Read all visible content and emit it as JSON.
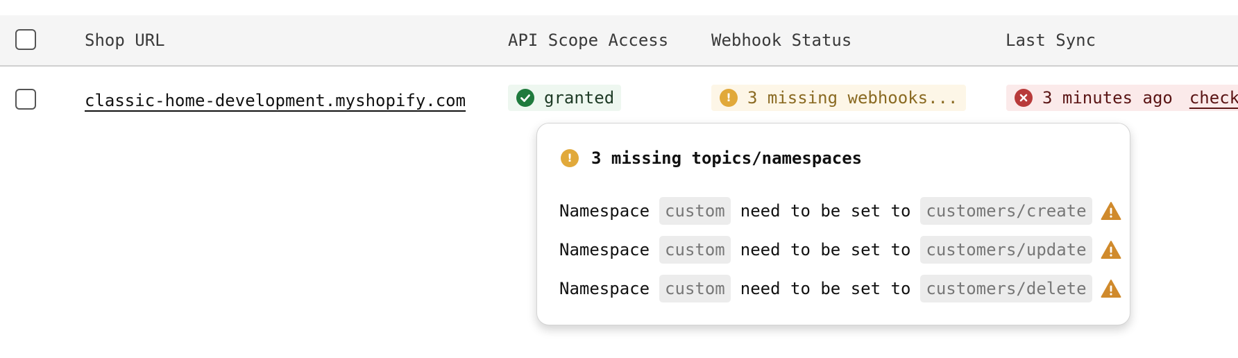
{
  "header": {
    "select_all_label": "",
    "shop_url": "Shop URL",
    "api_scope_access": "API Scope Access",
    "webhook_status": "Webhook Status",
    "last_sync": "Last Sync"
  },
  "rows": [
    {
      "shop_url": "classic-home-development.myshopify.com",
      "api_scope": {
        "status": "success",
        "label": "granted",
        "icon": "check-circle-icon",
        "color": "#1f7a3d"
      },
      "webhook": {
        "status": "warning",
        "label": "3 missing webhooks...",
        "icon": "exclamation-circle-icon",
        "color": "#e1a93a"
      },
      "last_sync": {
        "status": "error",
        "label": "3 minutes ago",
        "link": "check",
        "icon": "x-circle-icon",
        "color": "#b83a3a"
      }
    }
  ],
  "popover": {
    "title": "3 missing topics/namespaces",
    "icon": "exclamation-circle-icon",
    "items": [
      {
        "prefix": "Namespace",
        "namespace": "custom",
        "middle": "need to be set to",
        "topic": "customers/create",
        "icon": "warning-triangle-icon"
      },
      {
        "prefix": "Namespace",
        "namespace": "custom",
        "middle": "need to be set to",
        "topic": "customers/update",
        "icon": "warning-triangle-icon"
      },
      {
        "prefix": "Namespace",
        "namespace": "custom",
        "middle": "need to be set to",
        "topic": "customers/delete",
        "icon": "warning-triangle-icon"
      }
    ]
  },
  "colors": {
    "success": "#1f7a3d",
    "warning": "#e1a93a",
    "error": "#b83a3a",
    "warning_triangle": "#d08a2c"
  }
}
